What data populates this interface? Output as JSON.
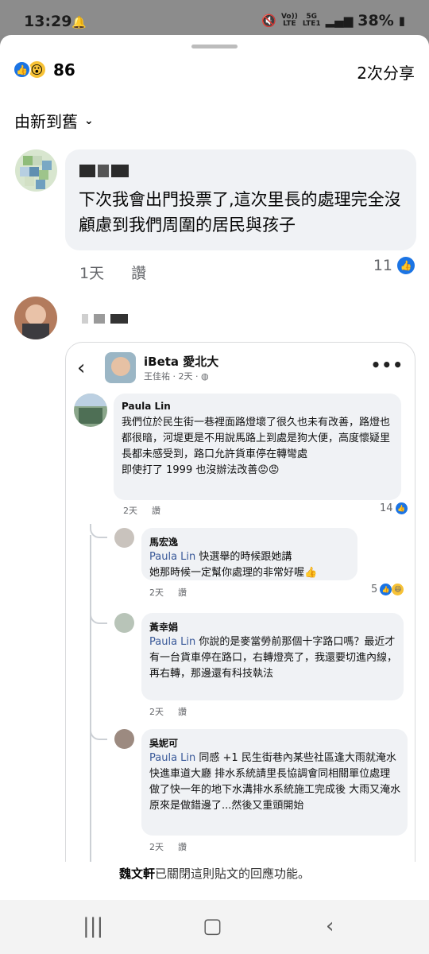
{
  "status_bar": {
    "time": "13:29",
    "network_top": "Vo))",
    "network_bottom": "LTE",
    "net2_top": "5G",
    "net2_bottom": "LTE1",
    "battery": "38%"
  },
  "header": {
    "reaction_count": "86",
    "shares": "2次分享"
  },
  "sort": {
    "label": "由新到舊"
  },
  "comments": [
    {
      "text": "下次我會出門投票了,這次里長的處理完全沒顧慮到我們周圍的居民與孩子",
      "time": "1天",
      "like_label": "讚",
      "reaction_count": "11"
    }
  ],
  "screenshot": {
    "page_name": "iBeta 愛北大",
    "page_sub": "王佳祐 · 2天 · ",
    "thread": [
      {
        "name": "Paula Lin",
        "text": "我們位於民生街一巷裡面路燈壞了很久也未有改善，路燈也都很暗，河堤更是不用說馬路上到處是狗大便，高度懷疑里長都未感受到，路口允許貨車停在轉彎處\n即使打了 1999 也沒辦法改善😡😡",
        "time": "2天",
        "like_label": "讚",
        "reactions": "14"
      },
      {
        "name": "馬宏逸",
        "mention": "Paula Lin",
        "text": " 快選舉的時候跟她講\n她那時候一定幫你處理的非常好喔👍",
        "time": "2天",
        "like_label": "讚",
        "reactions": "5"
      },
      {
        "name": "黃幸娟",
        "mention": "Paula Lin",
        "text": " 你說的是麥當勞前那個十字路口嗎？最近才有一台貨車停在路口，右轉燈亮了，我還要切進內線，再右轉，那邊還有科技執法",
        "time": "2天",
        "like_label": "讚"
      },
      {
        "name": "吳妮可",
        "mention": "Paula Lin",
        "text": " 同感 +1 民生街巷內某些社區逢大雨就淹水快進車道大廳 排水系統請里長協調會同相關單位處理 做了快一年的地下水溝排水系統施工完成後 大雨又淹水 原來是做錯邊了...然後又重頭開始",
        "time": "2天",
        "like_label": "讚"
      }
    ]
  },
  "closed_note": {
    "name": "魏文軒",
    "text": "已關閉這則貼文的回應功能。"
  },
  "colors": {
    "accent": "#1b74e4",
    "bubble": "#f0f2f5",
    "muted": "#65676b"
  }
}
